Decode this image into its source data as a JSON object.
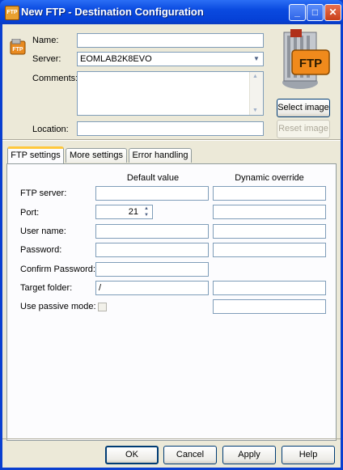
{
  "window": {
    "title": "New FTP - Destination Configuration",
    "icon": "ftp-app-icon",
    "controls": {
      "minimize": "_",
      "maximize": "□",
      "close": "✕"
    }
  },
  "header": {
    "name_label": "Name:",
    "name_value": "",
    "server_label": "Server:",
    "server_value": "EOMLAB2K8EVO",
    "comments_label": "Comments:",
    "comments_value": "",
    "location_label": "Location:",
    "location_value": "",
    "logo_text": "FTP",
    "select_image": "Select image",
    "reset_image": "Reset image"
  },
  "tabs": [
    {
      "label": "FTP settings",
      "active": true
    },
    {
      "label": "More settings",
      "active": false
    },
    {
      "label": "Error handling",
      "active": false
    }
  ],
  "ftp_settings": {
    "col_default": "Default value",
    "col_dynamic": "Dynamic override",
    "rows": [
      {
        "label": "FTP server:",
        "default": "",
        "dynamic": ""
      },
      {
        "label": "Port:",
        "default": "21",
        "dynamic": ""
      },
      {
        "label": "User name:",
        "default": "",
        "dynamic": ""
      },
      {
        "label": "Password:",
        "default": "",
        "dynamic": ""
      },
      {
        "label": "Confirm Password:",
        "default": ""
      },
      {
        "label": "Target folder:",
        "default": "/",
        "dynamic": ""
      },
      {
        "label": "Use passive mode:",
        "checked": false,
        "dynamic": ""
      }
    ]
  },
  "footer": {
    "ok": "OK",
    "cancel": "Cancel",
    "apply": "Apply",
    "help": "Help"
  },
  "colors": {
    "titlebar": "#0a4ae0",
    "dialog_bg": "#ece9d8",
    "tab_highlight": "#ffc83c",
    "logo_orange": "#f08a1c"
  }
}
